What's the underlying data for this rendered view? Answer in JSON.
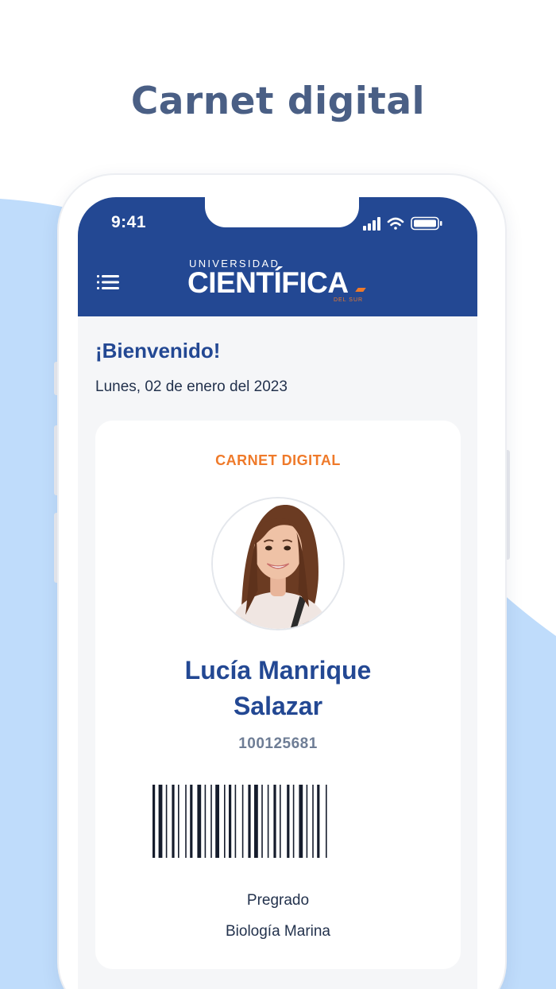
{
  "headline": "Carnet digital",
  "status_bar": {
    "time": "9:41"
  },
  "header": {
    "logo_top": "UNIVERSIDAD",
    "logo_main": "CIENTÍFICA",
    "logo_bottom": "DEL SUR",
    "menu_icon": "hamburger-menu-icon"
  },
  "welcome": {
    "greeting": "¡Bienvenido!",
    "date": "Lunes, 02 de enero del 2023"
  },
  "card": {
    "title": "CARNET DIGITAL",
    "name_line1": "Lucía Manrique",
    "name_line2": "Salazar",
    "student_code": "100125681",
    "program": "Pregrado",
    "career": "Biología Marina"
  },
  "colors": {
    "brand_blue": "#234893",
    "accent_orange": "#ef7a2a",
    "background_wave": "#bfdcfb",
    "headline": "#4a5f85"
  }
}
